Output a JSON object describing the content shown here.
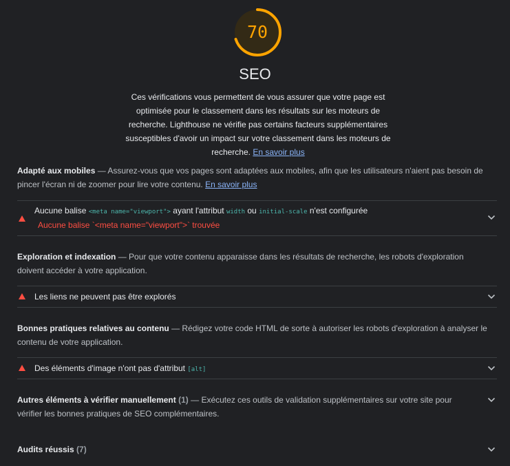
{
  "gauge": {
    "score": "70",
    "score_fraction": 0.7,
    "color": "#ffa400"
  },
  "category": {
    "title": "SEO",
    "desc_lines": [
      "Ces vérifications vous permettent de vous assurer que votre page est",
      "optimisée pour le classement dans les résultats sur les moteurs de",
      "recherche. Lighthouse ne vérifie pas certains facteurs supplémentaires",
      "susceptibles d'avoir un impact sur votre classement dans les moteurs de",
      "recherche."
    ],
    "learn_more": "En savoir plus"
  },
  "groups": {
    "mobile": {
      "title": "Adapté aux mobiles",
      "sep": " — ",
      "desc": "Assurez-vous que vos pages sont adaptées aux mobiles, afin que les utilisateurs n'aient pas besoin de pincer l'écran ni de zoomer pour lire votre contenu.",
      "learn_more": "En savoir plus"
    },
    "crawl": {
      "title": "Exploration et indexation",
      "sep": " — ",
      "desc": "Pour que votre contenu apparaisse dans les résultats de recherche, les robots d'exploration doivent accéder à votre application."
    },
    "content": {
      "title": "Bonnes pratiques relatives au contenu",
      "sep": " — ",
      "desc": "Rédigez votre code HTML de sorte à autoriser les robots d'exploration à analyser le contenu de votre application."
    },
    "manual": {
      "title": "Autres éléments à vérifier manuellement",
      "count": "(1)",
      "sep": " — ",
      "desc": "Exécutez ces outils de validation supplémentaires sur votre site pour vérifier les bonnes pratiques de SEO complémentaires."
    },
    "passed": {
      "title": "Audits réussis",
      "count": "(7)"
    }
  },
  "audits": {
    "viewport": {
      "t1": "Aucune balise ",
      "code1": "<meta name=\"viewport\">",
      "t2": " ayant l'attribut ",
      "code2": "width",
      "t3": " ou ",
      "code3": "initial-scale",
      "t4": " n'est configurée",
      "error": "Aucune balise `<meta name=\"viewport\">` trouvée"
    },
    "links": {
      "title": "Les liens ne peuvent pas être explorés"
    },
    "alt": {
      "t1": "Des éléments d'image n'ont pas d'attribut ",
      "code1": "[alt]"
    }
  },
  "icons": {
    "fail": "warning-triangle-icon",
    "expand": "chevron-down-icon"
  },
  "colors": {
    "fail": "#ff4e42",
    "average": "#ffa400",
    "link": "#8ab4f8",
    "code": "#4db6ac"
  }
}
